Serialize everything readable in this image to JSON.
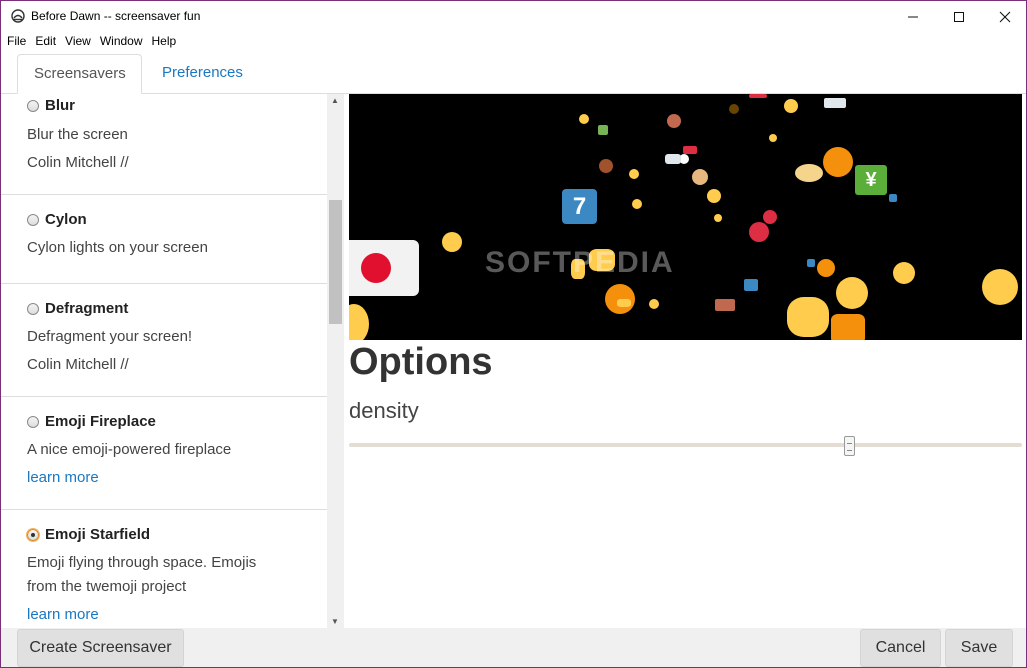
{
  "window": {
    "title": "Before Dawn -- screensaver fun"
  },
  "menu": [
    "File",
    "Edit",
    "View",
    "Window",
    "Help"
  ],
  "tabs": {
    "screensavers": "Screensavers",
    "preferences": "Preferences"
  },
  "screensavers": [
    {
      "name": "Blur",
      "description": "Blur the screen",
      "author": "Colin Mitchell //",
      "selected": false
    },
    {
      "name": "Cylon",
      "description": "Cylon lights on your screen",
      "selected": false
    },
    {
      "name": "Defragment",
      "description": "Defragment your screen!",
      "author": "Colin Mitchell //",
      "selected": false
    },
    {
      "name": "Emoji Fireplace",
      "description": "A nice emoji-powered fireplace",
      "link": "learn more",
      "selected": false
    },
    {
      "name": "Emoji Starfield",
      "description_line1": "Emoji flying through space. Emojis",
      "description_line2": "from the twemoji project",
      "link": "learn more",
      "selected": true
    }
  ],
  "preview": {
    "watermark": "SOFTPEDIA",
    "seven_glyph": "7",
    "yen_glyph": "¥"
  },
  "options": {
    "title": "Options",
    "density_label": "density",
    "density_value": 0.745
  },
  "buttons": {
    "create": "Create Screensaver",
    "cancel": "Cancel",
    "save": "Save"
  },
  "icons": {
    "minimize": "minimize-icon",
    "maximize": "maximize-icon",
    "close": "close-icon"
  }
}
